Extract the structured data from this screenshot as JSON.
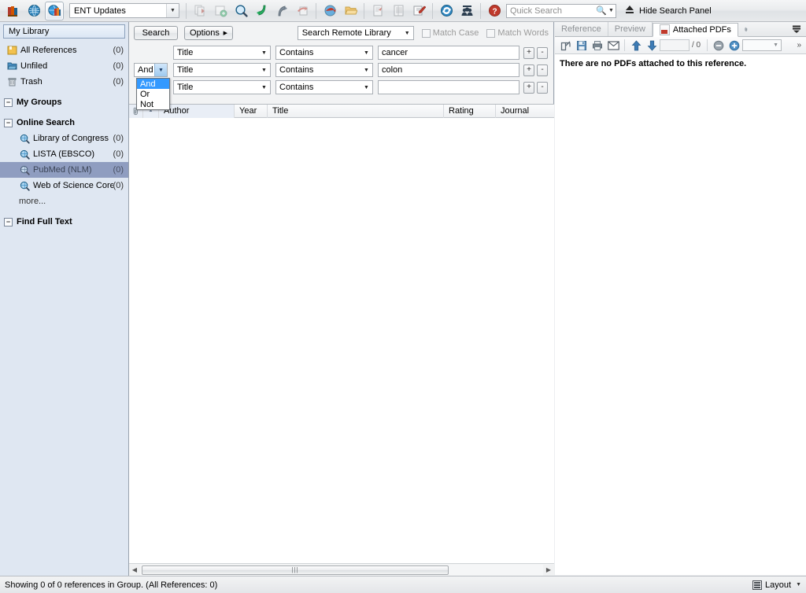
{
  "toolbar": {
    "style_value": "ENT Updates",
    "icons": [
      {
        "name": "library-icon"
      },
      {
        "name": "globe-icon"
      },
      {
        "name": "online-search-mode-icon"
      },
      {
        "name": "copy-references-icon"
      },
      {
        "name": "new-reference-icon"
      },
      {
        "name": "find-reference-updates-icon"
      },
      {
        "name": "go-to-reference-icon"
      },
      {
        "name": "export-icon"
      },
      {
        "name": "import-icon"
      },
      {
        "name": "open-link-icon"
      },
      {
        "name": "open-file-attachment-icon"
      },
      {
        "name": "format-bibliography-icon"
      },
      {
        "name": "insert-citation-icon"
      },
      {
        "name": "edit-citation-icon"
      },
      {
        "name": "sync-icon"
      },
      {
        "name": "share-group-icon"
      },
      {
        "name": "help-icon"
      }
    ],
    "quick_search_placeholder": "Quick Search",
    "quick_search_value": "",
    "hide_panel_label": "Hide Search Panel"
  },
  "sidebar": {
    "library_header": "My Library",
    "top_items": [
      {
        "label": "All References",
        "count": "(0)",
        "icon": "folder-yellow-icon"
      },
      {
        "label": "Unfiled",
        "count": "(0)",
        "icon": "folder-blue-icon"
      },
      {
        "label": "Trash",
        "count": "(0)",
        "icon": "trash-icon"
      }
    ],
    "groups_header": "My Groups",
    "online_search_header": "Online Search",
    "online_items": [
      {
        "label": "Library of Congress",
        "count": "(0)",
        "selected": false
      },
      {
        "label": "LISTA (EBSCO)",
        "count": "(0)",
        "selected": false
      },
      {
        "label": "PubMed (NLM)",
        "count": "(0)",
        "selected": true
      },
      {
        "label": "Web of Science Core...",
        "count": "(0)",
        "selected": false
      }
    ],
    "more_label": "more...",
    "find_full_text_header": "Find Full Text"
  },
  "search": {
    "search_button": "Search",
    "options_button": "Options",
    "options_caret": "▶",
    "remote_library": "Search Remote Library",
    "match_case": "Match Case",
    "match_words": "Match Words",
    "rows": [
      {
        "operator": "",
        "field": "Title",
        "comparator": "Contains",
        "term": "cancer",
        "term_placeholder": ""
      },
      {
        "operator": "And",
        "field": "Title",
        "comparator": "Contains",
        "term": "colon",
        "term_placeholder": ""
      },
      {
        "operator": "And",
        "field": "Title",
        "comparator": "Contains",
        "term": "",
        "term_placeholder": ""
      }
    ],
    "add_row_label": "+",
    "remove_row_label": "-",
    "operator_dropdown": {
      "open": true,
      "options": [
        "And",
        "Or",
        "Not"
      ],
      "highlighted": "And"
    }
  },
  "result_list": {
    "columns": [
      {
        "key": "attachment",
        "label": ""
      },
      {
        "key": "pdf",
        "label": ""
      },
      {
        "key": "author",
        "label": "Author"
      },
      {
        "key": "year",
        "label": "Year"
      },
      {
        "key": "title",
        "label": "Title"
      },
      {
        "key": "rating",
        "label": "Rating"
      },
      {
        "key": "journal",
        "label": "Journal"
      }
    ],
    "rows": [],
    "sort_indicator": "▲"
  },
  "right_panel": {
    "tabs": [
      {
        "label": "Reference",
        "active": false
      },
      {
        "label": "Preview",
        "active": false
      },
      {
        "label": "Attached PDFs",
        "active": true,
        "icon": "pdf-icon"
      }
    ],
    "clip_tab_icon": "paperclip-icon",
    "tab_menu_icon": "panel-menu-icon",
    "pdf_toolbar_icons": [
      {
        "name": "open-external-icon"
      },
      {
        "name": "save-icon"
      },
      {
        "name": "print-icon"
      },
      {
        "name": "email-icon"
      },
      {
        "name": "previous-page-icon"
      },
      {
        "name": "next-page-icon"
      },
      {
        "name": "zoom-out-icon"
      },
      {
        "name": "zoom-in-icon"
      }
    ],
    "page_value": "",
    "page_total": "/ 0",
    "zoom_value": "",
    "overflow_icon": "»",
    "empty_message": "There are no PDFs attached to this reference."
  },
  "status_bar": {
    "text": "Showing 0 of 0 references in Group. (All References: 0)",
    "layout_label": "Layout"
  },
  "colors": {
    "sidebar_bg": "#dfe7f2",
    "selection": "#8f9dc0",
    "dropdown_highlight": "#3399ff",
    "accent_red": "#c0392b"
  }
}
